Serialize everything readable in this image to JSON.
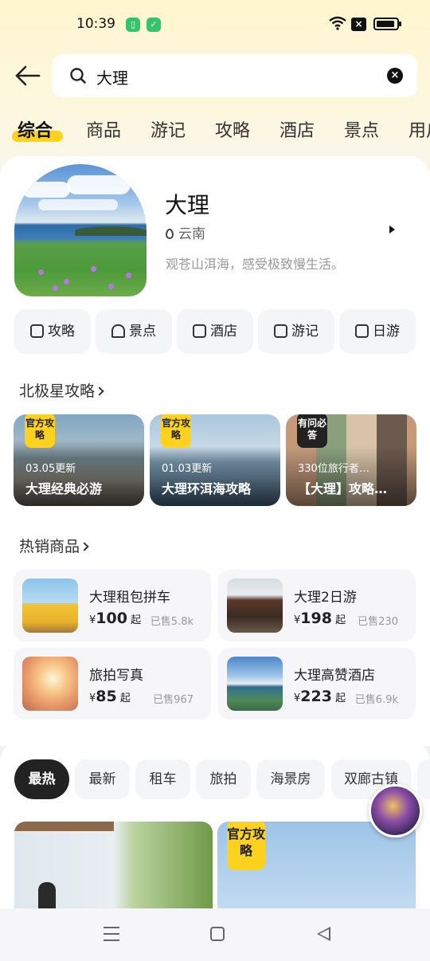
{
  "status_bar": {
    "time": "10:39"
  },
  "search": {
    "query": "大理"
  },
  "tabs": [
    {
      "label": "综合"
    },
    {
      "label": "商品"
    },
    {
      "label": "游记"
    },
    {
      "label": "攻略"
    },
    {
      "label": "酒店"
    },
    {
      "label": "景点"
    },
    {
      "label": "用户"
    }
  ],
  "destination": {
    "name": "大理",
    "region": "云南",
    "tagline": "观苍山洱海，感受极致慢生活。"
  },
  "quick_links": [
    {
      "label": "攻略",
      "icon": "guide-icon"
    },
    {
      "label": "景点",
      "icon": "mountain-icon"
    },
    {
      "label": "酒店",
      "icon": "hotel-icon"
    },
    {
      "label": "游记",
      "icon": "book-icon"
    },
    {
      "label": "日游",
      "icon": "ticket-icon"
    }
  ],
  "guides_section": {
    "title": "北极星攻略"
  },
  "guides": [
    {
      "badge": "官方攻略",
      "date": "03.05更新",
      "title": "大理经典必游"
    },
    {
      "badge": "官方攻略",
      "date": "01.03更新",
      "title": "大理环洱海攻略"
    },
    {
      "badge": "有问必答",
      "date": "330位旅行者…",
      "title": "【大理】攻略…"
    }
  ],
  "products_section": {
    "title": "热销商品"
  },
  "products": [
    {
      "name": "大理租包拼车",
      "currency": "¥",
      "price": "100",
      "suffix": "起",
      "sold": "已售5.8k"
    },
    {
      "name": "大理2日游",
      "currency": "¥",
      "price": "198",
      "suffix": "起",
      "sold": "已售230"
    },
    {
      "name": "旅拍写真",
      "currency": "¥",
      "price": "85",
      "suffix": "起",
      "sold": "已售967"
    },
    {
      "name": "大理高赞酒店",
      "currency": "¥",
      "price": "223",
      "suffix": "起",
      "sold": "已售6.9k"
    }
  ],
  "filter_chips": [
    {
      "label": "最热"
    },
    {
      "label": "最新"
    },
    {
      "label": "租车"
    },
    {
      "label": "旅拍"
    },
    {
      "label": "海景房"
    },
    {
      "label": "双廊古镇"
    }
  ],
  "feed": {
    "badge": "官方攻略"
  },
  "colors": {
    "accent": "#ffd21f",
    "dark": "#222222",
    "muted": "#999999"
  }
}
